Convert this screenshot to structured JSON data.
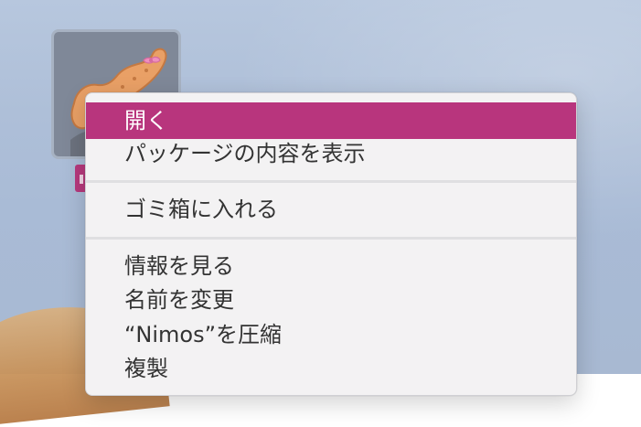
{
  "desktop": {
    "app_icon": {
      "icon": "seahorse-app-icon"
    },
    "label_color": "#b7397d"
  },
  "context_menu": {
    "highlight_color": "#b8357d",
    "items": [
      {
        "label": "開く",
        "highlighted": true
      },
      {
        "label": "パッケージの内容を表示"
      },
      {
        "label": "ゴミ箱に入れる"
      },
      {
        "label": "情報を見る"
      },
      {
        "label": "名前を変更"
      },
      {
        "label": "“Nimos”を圧縮"
      },
      {
        "label": "複製"
      }
    ]
  }
}
